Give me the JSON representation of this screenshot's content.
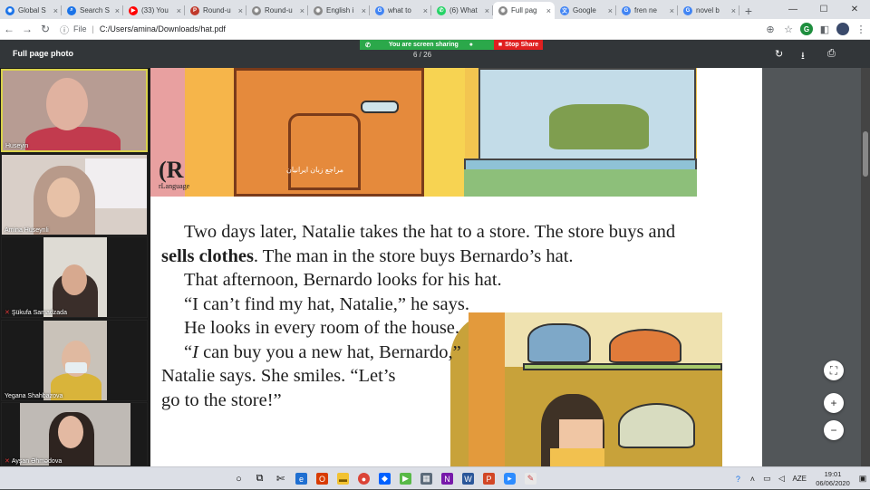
{
  "tabs": [
    {
      "label": "Global S",
      "favicon_color": "#1a73e8",
      "icon": "globe-icon"
    },
    {
      "label": "Search S",
      "favicon_color": "#1a73e8",
      "icon": "search-icon"
    },
    {
      "label": "(33) You",
      "favicon_color": "#ff0000",
      "icon": "youtube-icon"
    },
    {
      "label": "Round-u",
      "favicon_color": "#c0392b",
      "icon": "pdf-icon"
    },
    {
      "label": "Round-u",
      "favicon_color": "#888888",
      "icon": "globe-icon"
    },
    {
      "label": "English i",
      "favicon_color": "#888888",
      "icon": "globe-icon"
    },
    {
      "label": "what to",
      "favicon_color": "#4285f4",
      "icon": "google-icon"
    },
    {
      "label": "(6) What",
      "favicon_color": "#25d366",
      "icon": "whatsapp-icon"
    },
    {
      "label": "Full pag",
      "favicon_color": "#888888",
      "icon": "globe-icon",
      "active": true
    },
    {
      "label": "Google",
      "favicon_color": "#4285f4",
      "icon": "translate-icon"
    },
    {
      "label": "fren ne",
      "favicon_color": "#4285f4",
      "icon": "google-icon"
    },
    {
      "label": "novel b",
      "favicon_color": "#4285f4",
      "icon": "google-icon"
    }
  ],
  "address": {
    "file_label": "File",
    "url": "C:/Users/amina/Downloads/hat.pdf"
  },
  "pdf": {
    "title": "Full page photo",
    "page_indicator": "6 / 26",
    "sharing_text": "You are screen sharing",
    "stop_share": "Stop Share"
  },
  "participants": [
    {
      "name": "Huseyin",
      "muted": false,
      "speaking": true
    },
    {
      "name": "Amina Huseynli",
      "muted": false
    },
    {
      "name": "Şükufa Samadzada",
      "muted": true
    },
    {
      "name": "Yegana Shahbazova",
      "muted": false
    },
    {
      "name": "Ayşan Əhmədova",
      "muted": true
    }
  ],
  "story": {
    "line1": "Two days later, Natalie takes the hat to a store. The store buys and",
    "line2_bold": "sells clothes",
    "line2_rest": ". The man in the store buys Bernardo’s hat.",
    "line3": "That afternoon, Bernardo looks for his hat.",
    "line4": "“I can’t find my hat, Natalie,” he says.",
    "line5": "He looks in every room of the house.",
    "line6_open": "“",
    "line6_i": "I",
    "line6_rest": " can buy you a new hat, Bernardo,”",
    "line7": "Natalie says. She smiles. “Let’s",
    "line8": "go to the store!”"
  },
  "watermark": "مراجع زبان ایرانیان",
  "logo_text": "rLanguage",
  "taskbar": {
    "lang": "AZE",
    "time": "19:01",
    "date": "06/06/2020"
  }
}
